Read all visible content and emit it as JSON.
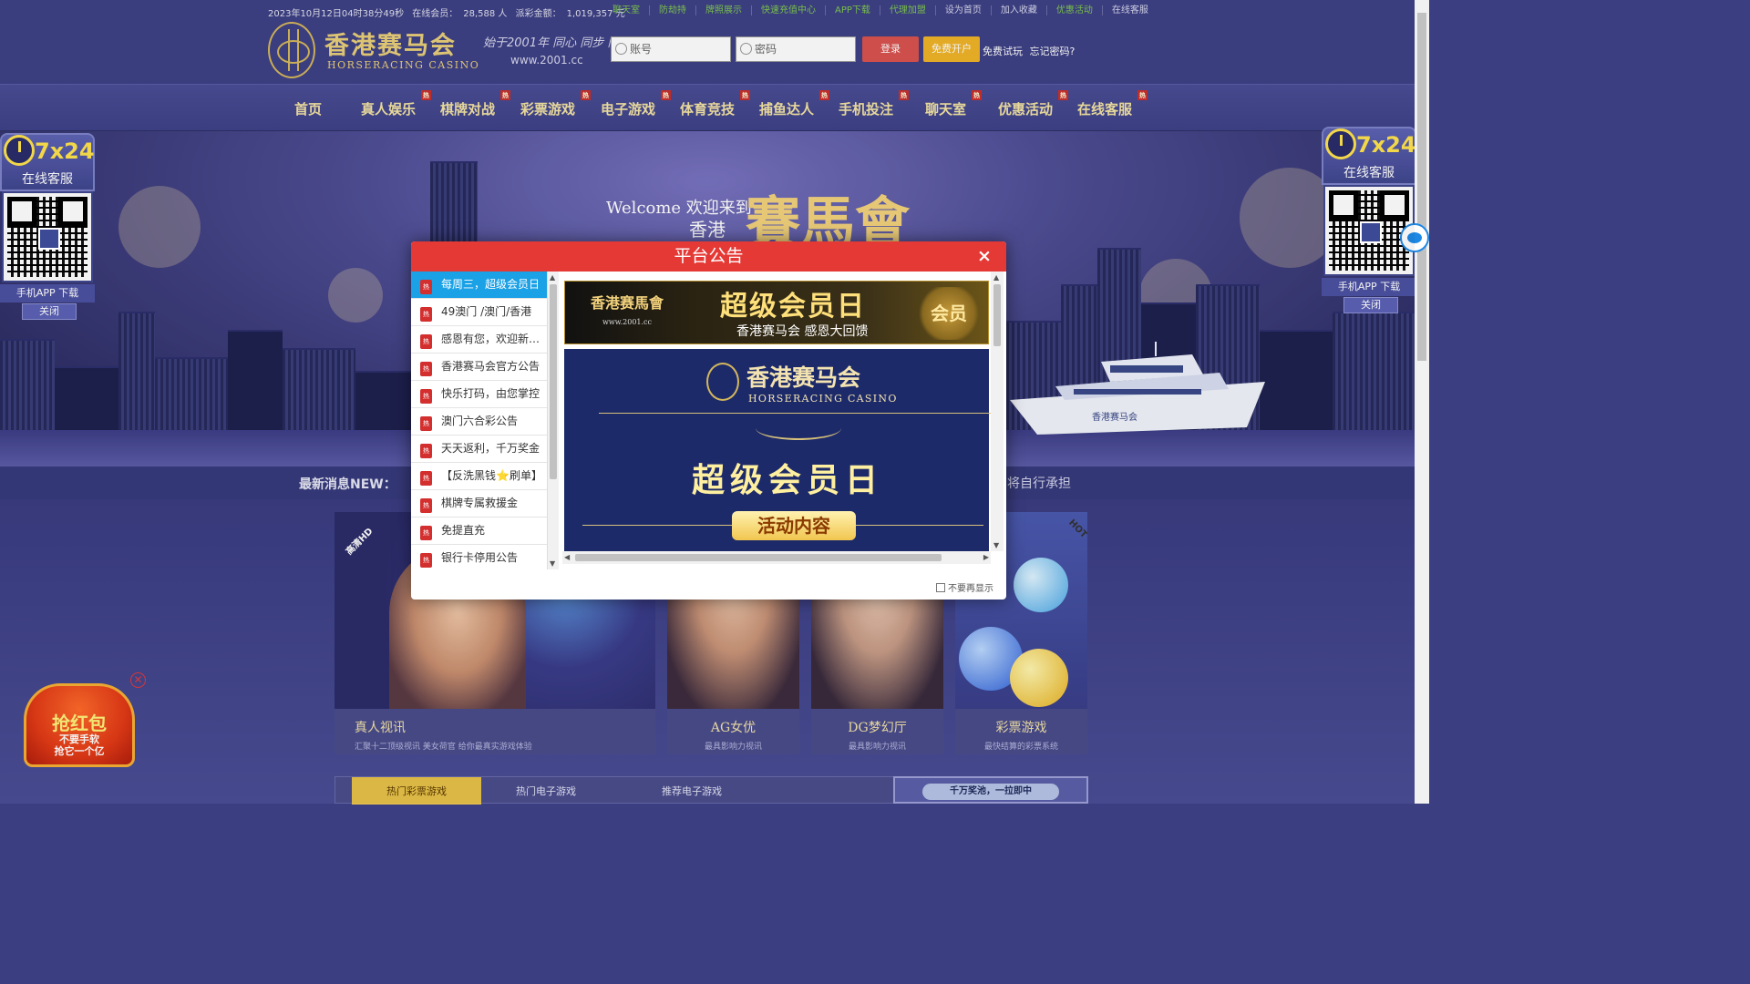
{
  "topbar": {
    "datetime": "2023年10月12日04时38分49秒",
    "online_label": "在线会员：",
    "online_value": "28,588 人",
    "payout_label": "派彩金额：",
    "payout_value": "1,019,357 元",
    "links": [
      {
        "label": "聊天室",
        "color": "#7fc94f"
      },
      {
        "label": "防劫持",
        "color": "#7fc94f"
      },
      {
        "label": "牌照展示",
        "color": "#7fc94f"
      },
      {
        "label": "快速充值中心",
        "color": "#7fc94f"
      },
      {
        "label": "APP下载",
        "color": "#7fc94f"
      },
      {
        "label": "代理加盟",
        "color": "#7fc94f"
      },
      {
        "label": "设为首页",
        "color": "#d8d9ee"
      },
      {
        "label": "加入收藏",
        "color": "#d8d9ee"
      },
      {
        "label": "优惠活动",
        "color": "#7fc94f"
      },
      {
        "label": "在线客服",
        "color": "#d8d9ee"
      }
    ]
  },
  "header": {
    "logo_title": "香港赛马会",
    "logo_sub": "HORSERACING CASINO",
    "slogan": "始于2001年 同心 同步 同进",
    "slogan_url": "www.2001.cc",
    "username_placeholder": "账号",
    "password_placeholder": "密码",
    "login_label": "登录",
    "register_label": "免费开户",
    "trial_label": "免费试玩",
    "forgot_label": "忘记密码?"
  },
  "nav": {
    "hot_badge": "热",
    "items": [
      {
        "label": "首页",
        "hot": false
      },
      {
        "label": "真人娱乐",
        "hot": true
      },
      {
        "label": "棋牌对战",
        "hot": true
      },
      {
        "label": "彩票游戏",
        "hot": true
      },
      {
        "label": "电子游戏",
        "hot": true
      },
      {
        "label": "体育竞技",
        "hot": true
      },
      {
        "label": "捕鱼达人",
        "hot": true
      },
      {
        "label": "手机投注",
        "hot": true
      },
      {
        "label": "聊天室",
        "hot": true
      },
      {
        "label": "优惠活动",
        "hot": true
      },
      {
        "label": "在线客服",
        "hot": true
      }
    ]
  },
  "banner": {
    "welcome": "Welcome 欢迎来到",
    "welcome_hk": "香港",
    "welcome_brand": "賽馬會",
    "yacht_text": "香港赛马会"
  },
  "ticker": {
    "label": "最新消息NEW：",
    "text": "将自行承担"
  },
  "side_widget": {
    "hours": "7x24",
    "service": "在线客服",
    "app_label": "手机APP 下载",
    "close_label": "关闭"
  },
  "panels": [
    {
      "title": "真人视讯",
      "subtitle": "汇聚十二顶级视讯  美女荷官 给你最真实游戏体验",
      "tag": "高清HD",
      "tag_color": "#e8572a"
    },
    {
      "title": "AG女优",
      "subtitle": "最具影响力视讯"
    },
    {
      "title": "DG梦幻厅",
      "subtitle": "最具影响力视讯"
    },
    {
      "title": "彩票游戏",
      "subtitle": "最快结算的彩票系统",
      "tag": "HOT",
      "tag_color": "#e7c24a"
    }
  ],
  "bottom_tabs": [
    {
      "label": "热门彩票游戏",
      "active": true
    },
    {
      "label": "热门电子游戏",
      "active": false
    },
    {
      "label": "推荐电子游戏",
      "active": false
    }
  ],
  "jackpot": {
    "label": "千万奖池，一拉即中"
  },
  "redpacket": {
    "title": "抢红包",
    "line1": "不要手软",
    "line2": "抢它一个亿",
    "close": "✕"
  },
  "modal": {
    "title": "平台公告",
    "close": "×",
    "hot_icon": "热",
    "notices": [
      "每周三，超级会员日",
      "49澳门 /澳门/香港",
      "感恩有您，欢迎新会员",
      "香港赛马会官方公告",
      "快乐打码，由您掌控",
      "澳门六合彩公告",
      "天天返利，千万奖金",
      "【反洗黑钱⭐刷单】",
      "棋牌专属救援金",
      "免提直充",
      "银行卡停用公告"
    ],
    "active_index": 0,
    "ad1": {
      "logo": "香港赛馬會",
      "logo_url": "www.2001.cc",
      "big": "超级会员日",
      "small": "香港赛马会 感恩大回馈",
      "badge": "会员"
    },
    "ad2": {
      "brand": "香港赛马会",
      "brand_en": "HORSERACING CASINO",
      "title": "超级会员日",
      "button": "活动内容"
    },
    "dont_show": "不要再显示"
  }
}
